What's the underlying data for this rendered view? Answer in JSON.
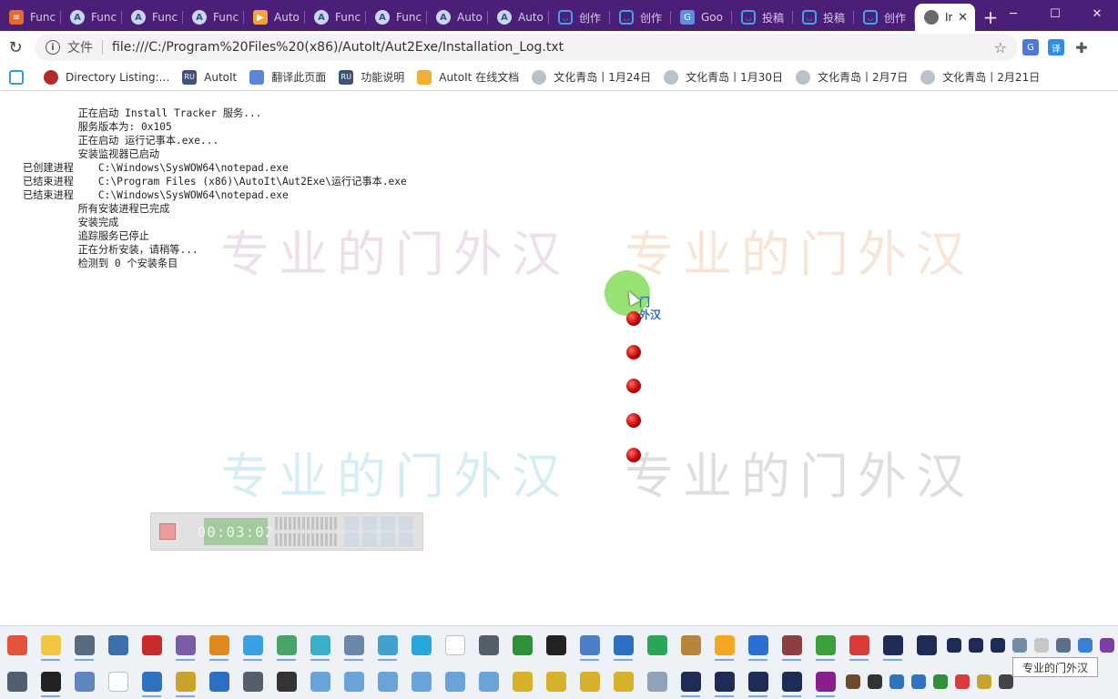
{
  "tabs": [
    {
      "title": "Func",
      "icon": "doc-icon"
    },
    {
      "title": "Func",
      "icon": "autoit-icon"
    },
    {
      "title": "Func",
      "icon": "autoit-icon"
    },
    {
      "title": "Func",
      "icon": "autoit-icon"
    },
    {
      "title": "Auto",
      "icon": "folder-icon"
    },
    {
      "title": "Func",
      "icon": "autoit-icon"
    },
    {
      "title": "Func",
      "icon": "autoit-icon"
    },
    {
      "title": "Auto",
      "icon": "autoit-icon"
    },
    {
      "title": "Auto",
      "icon": "autoit-icon"
    },
    {
      "title": "创作",
      "icon": "bilibili-icon"
    },
    {
      "title": "创作",
      "icon": "bilibili-icon"
    },
    {
      "title": "Goo",
      "icon": "translate-icon"
    },
    {
      "title": "投稿",
      "icon": "bilibili-icon"
    },
    {
      "title": "投稿",
      "icon": "bilibili-icon"
    },
    {
      "title": "创作",
      "icon": "bilibili-icon"
    },
    {
      "title": "Ir",
      "icon": "globe-icon",
      "active": true
    }
  ],
  "address": {
    "scheme_label": "文件",
    "url": "file:///C:/Program%20Files%20(x86)/AutoIt/Aut2Exe/Installation_Log.txt"
  },
  "bookmarks": [
    {
      "label": "",
      "icon": "bilibili-icon"
    },
    {
      "label": "Directory Listing:...",
      "icon": "red-bird-icon"
    },
    {
      "label": "AutoIt",
      "icon": "ru-icon"
    },
    {
      "label": "翻译此页面",
      "icon": "translate-icon"
    },
    {
      "label": "功能说明",
      "icon": "ru-icon"
    },
    {
      "label": "AutoIt 在线文档",
      "icon": "folder-icon"
    },
    {
      "label": "文化青岛丨1月24日",
      "icon": "eye-icon"
    },
    {
      "label": "文化青岛丨1月30日",
      "icon": "eye-icon"
    },
    {
      "label": "文化青岛丨2月7日",
      "icon": "eye-icon"
    },
    {
      "label": "文化青岛丨2月21日",
      "icon": "eye-icon"
    }
  ],
  "log_lines": [
    "         正在启动 Install Tracker 服务...",
    "         服务版本为: 0x105",
    "         正在启动 运行记事本.exe...",
    "         安装监视器已启动",
    "已创建进程    C:\\Windows\\SysWOW64\\notepad.exe",
    "已结束进程    C:\\Program Files (x86)\\AutoIt\\Aut2Exe\\运行记事本.exe",
    "已结束进程    C:\\Windows\\SysWOW64\\notepad.exe",
    "         所有安装进程已完成",
    "         安装完成",
    "         追踪服务已停止",
    "         正在分析安装，请稍等...",
    "         检测到 0 个安装条目"
  ],
  "watermark_text": "专业的门外汉",
  "cursor_label": "门\n外汉",
  "recorder": {
    "time": "00:03:02"
  },
  "taskbar_tooltip": "专业的门外汉",
  "taskbar_row1_colors": [
    "#e3533b",
    "#f4c542",
    "#5a6b7d",
    "#3f6fa8",
    "#c92a2a",
    "#7a5ca8",
    "#e08a1e",
    "#3aa0e8",
    "#48a56a",
    "#3ab0c8",
    "#6b88aa",
    "#44a0cc",
    "#2aa5d8",
    "#ffffff",
    "#555f6b",
    "#2f8f3a",
    "#222222",
    "#4d7cc8",
    "#2d6fc0",
    "#2aa55a",
    "#b8863a",
    "#f5a623",
    "#2d6fd1",
    "#8a4040",
    "#3b9f3b",
    "#d93a3a",
    "#1d2b56",
    "#1d2b56",
    "#1d2b56",
    "#1d2b56",
    "#1d2b56",
    "#6f8ca8",
    "#c7c7c7",
    "#5a6f88",
    "#3a7fd0",
    "#7a3fa0"
  ],
  "taskbar_row2_colors": [
    "#506070",
    "#222222",
    "#5f86c0",
    "#ffffff",
    "#2f72c0",
    "#c9a22e",
    "#2b6fc0",
    "#555f6b",
    "#333333",
    "#6aa3d8",
    "#6aa3d8",
    "#6aa3d8",
    "#6aa3d8",
    "#6aa3d8",
    "#6aa3d8",
    "#d6b12a",
    "#d6b12a",
    "#d6b12a",
    "#d6b12a",
    "#8fa2b8",
    "#1d2b56",
    "#1d2b56",
    "#1d2b56",
    "#1d2b56",
    "#8a1f8a",
    "#6a4a2a",
    "#333333",
    "#2f72c0",
    "#2f72c0",
    "#2f8f3a",
    "#d93a3a",
    "#c9a22e",
    "#444444"
  ]
}
